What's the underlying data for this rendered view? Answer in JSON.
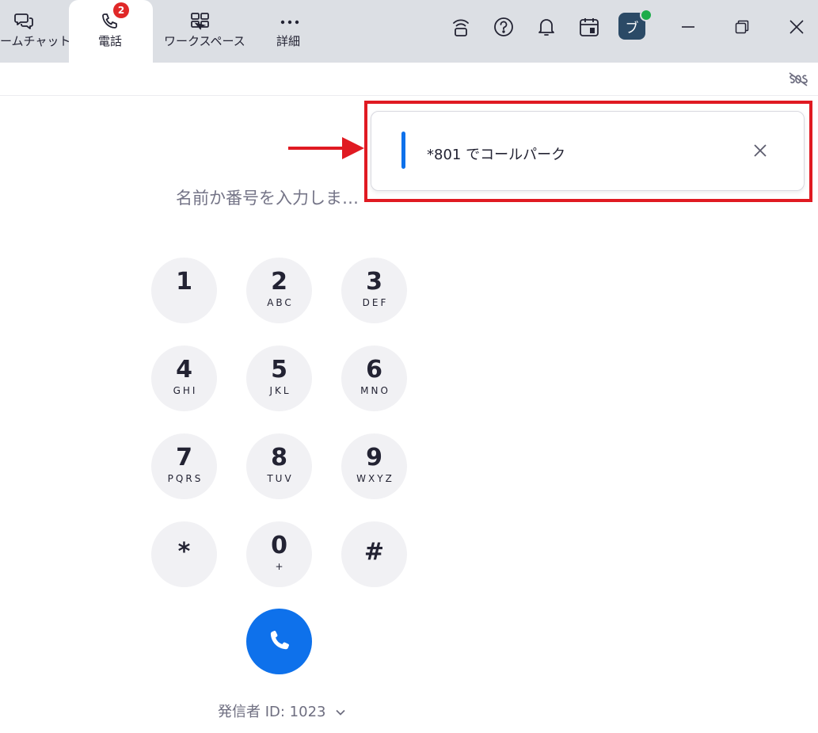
{
  "topbar": {
    "tabs": [
      {
        "label": "ームチャット",
        "icon": "chat-bubbles-icon"
      },
      {
        "label": "電話",
        "icon": "phone-icon",
        "badge": "2",
        "active": true
      },
      {
        "label": "ワークスペース",
        "icon": "workspace-icon"
      },
      {
        "label": "詳細",
        "icon": "more-dots-icon"
      }
    ],
    "right_icons": [
      "wireless-icon",
      "help-icon",
      "bell-icon",
      "calendar-icon"
    ],
    "avatar_initial": "ブ",
    "presence_color": "#1dac4a"
  },
  "dialer": {
    "placeholder": "名前か番号を入力しま…",
    "keys": [
      {
        "digit": "1",
        "letters": ""
      },
      {
        "digit": "2",
        "letters": "ABC"
      },
      {
        "digit": "3",
        "letters": "DEF"
      },
      {
        "digit": "4",
        "letters": "GHI"
      },
      {
        "digit": "5",
        "letters": "JKL"
      },
      {
        "digit": "6",
        "letters": "MNO"
      },
      {
        "digit": "7",
        "letters": "PQRS"
      },
      {
        "digit": "8",
        "letters": "TUV"
      },
      {
        "digit": "9",
        "letters": "WXYZ"
      },
      {
        "digit": "*",
        "letters": ""
      },
      {
        "digit": "0",
        "letters": "+"
      },
      {
        "digit": "#",
        "letters": ""
      }
    ],
    "caller_id": "発信者 ID: 1023"
  },
  "toast": {
    "message": "*801 でコールパーク"
  },
  "colors": {
    "accent": "#0e71eb",
    "annotation": "#e01a22",
    "badge": "#e02828"
  }
}
